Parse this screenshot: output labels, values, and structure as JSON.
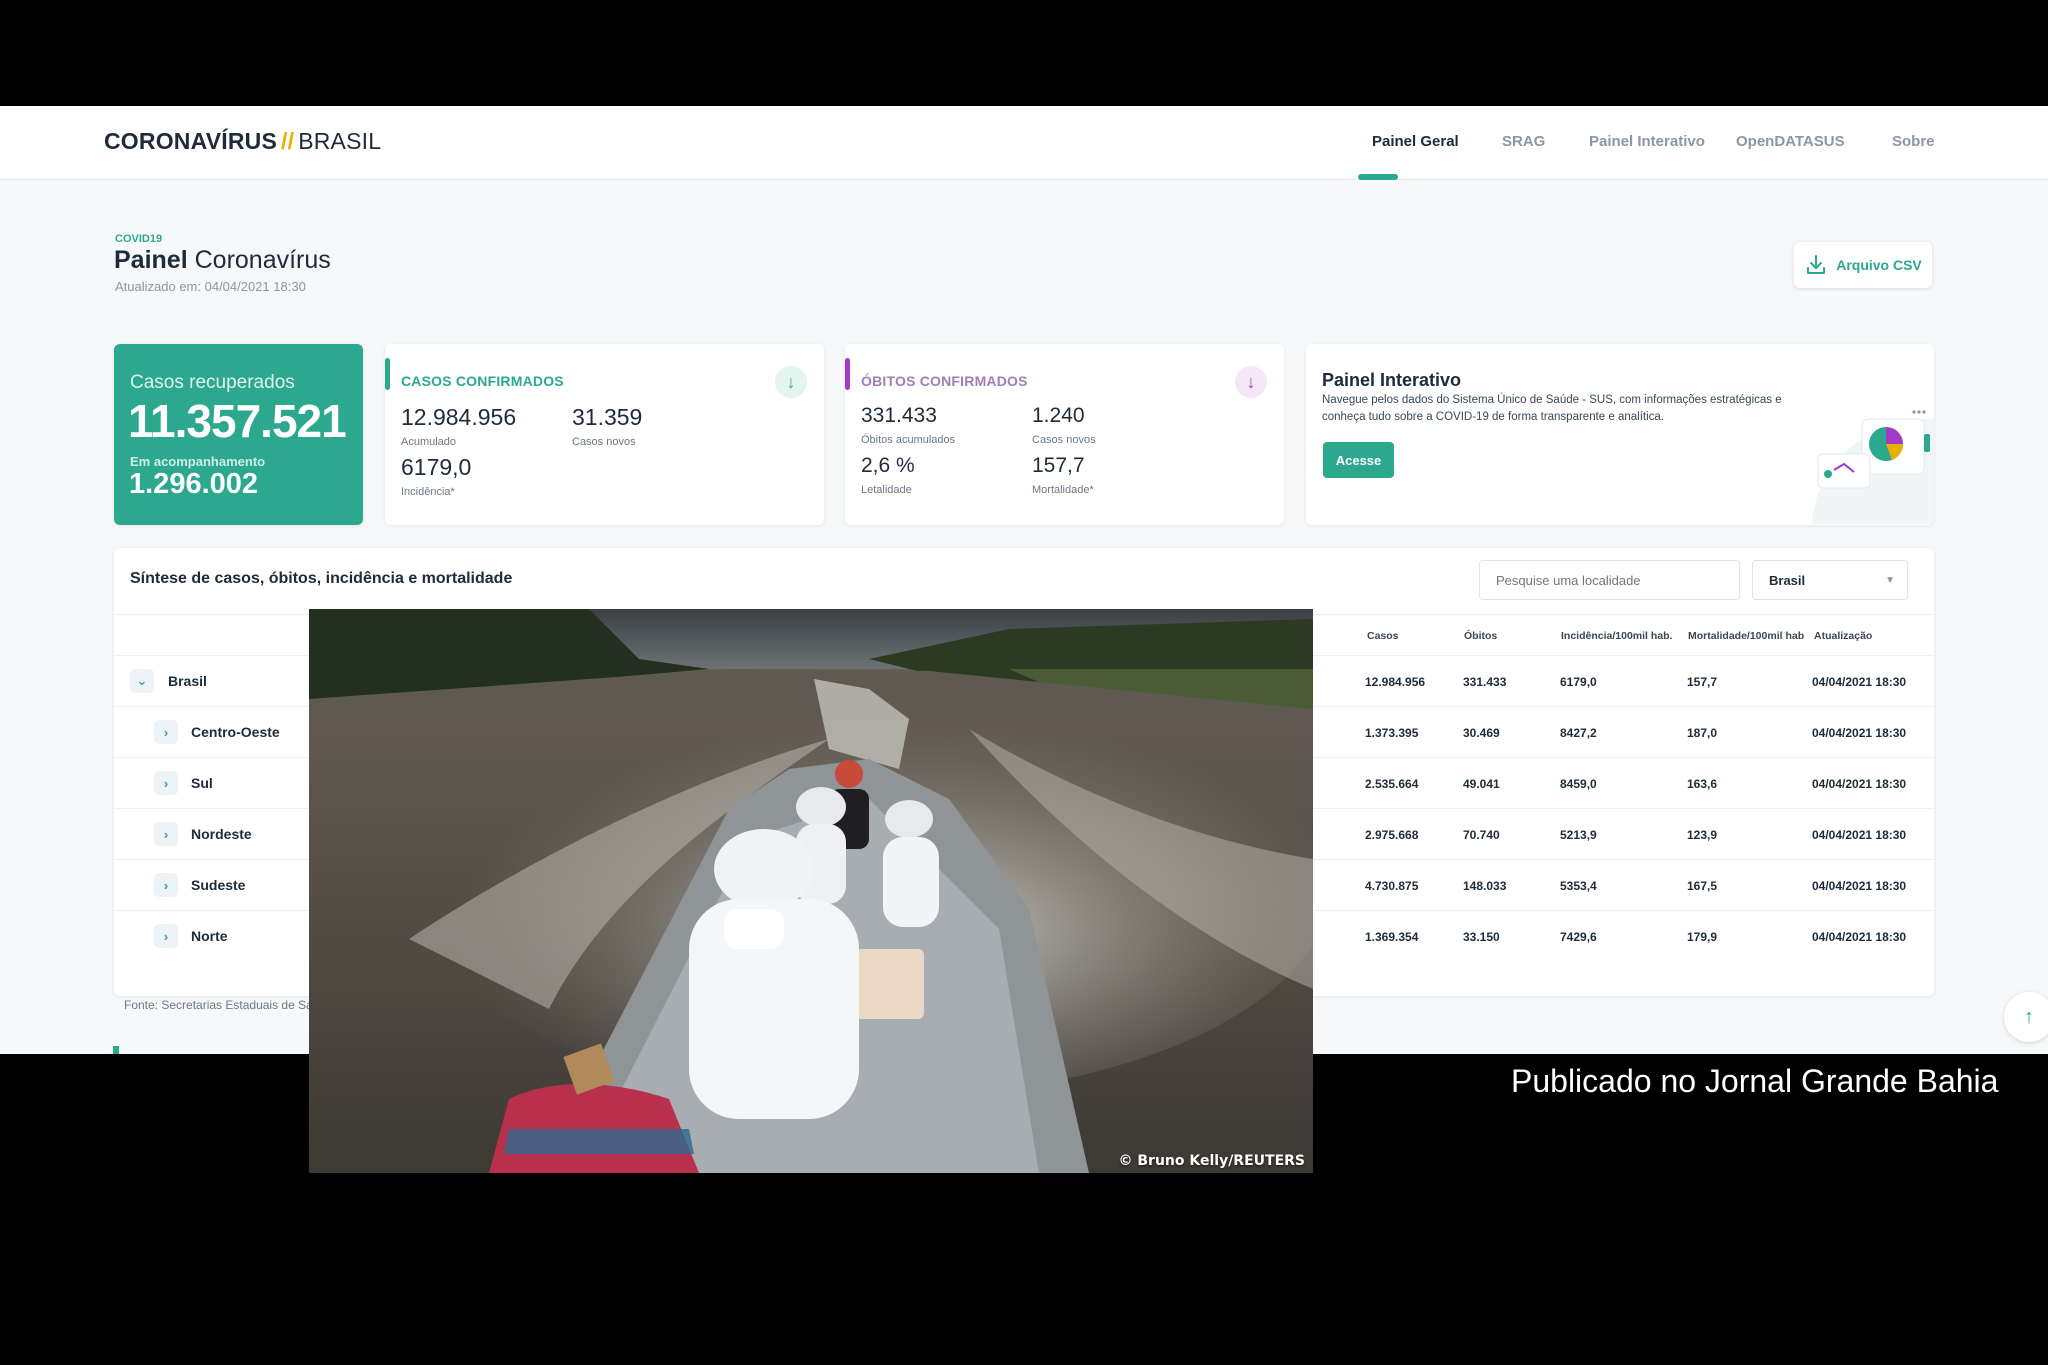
{
  "header": {
    "logo_bold": "CORONAVÍRUS",
    "logo_slash": "//",
    "logo_rest": "BRASIL",
    "nav": [
      {
        "label": "Painel Geral",
        "active": true
      },
      {
        "label": "SRAG"
      },
      {
        "label": "Painel Interativo"
      },
      {
        "label": "OpenDATASUS"
      },
      {
        "label": "Sobre"
      }
    ]
  },
  "page": {
    "kicker": "COVID19",
    "title_bold": "Painel",
    "title_rest": "Coronavírus",
    "updated": "Atualizado em: 04/04/2021 18:30",
    "csv_label": "Arquivo CSV"
  },
  "recovered": {
    "label": "Casos recuperados",
    "value": "11.357.521",
    "follow_label": "Em acompanhamento",
    "follow_value": "1.296.002"
  },
  "confirmed": {
    "title": "CASOS CONFIRMADOS",
    "accum": "12.984.956",
    "accum_label": "Acumulado",
    "new": "31.359",
    "new_label": "Casos novos",
    "incid": "6179,0",
    "incid_label": "Incidência*"
  },
  "deaths": {
    "title": "ÓBITOS CONFIRMADOS",
    "accum": "331.433",
    "accum_label": "Óbitos acumulados",
    "new": "1.240",
    "new_label": "Casos novos",
    "lethality": "2,6 %",
    "lethality_label": "Letalidade",
    "mortality": "157,7",
    "mortality_label": "Mortalidade*"
  },
  "interactive": {
    "title": "Painel Interativo",
    "desc": "Navegue pelos dados do Sistema Único de Saúde - SUS, com informações estratégicas e conheça tudo sobre a COVID-19 de forma transparente e analítica.",
    "button": "Acesse"
  },
  "table": {
    "title": "Síntese de casos, óbitos, incidência e mortalidade",
    "search_placeholder": "Pesquise uma localidade",
    "select_value": "Brasil",
    "headers": [
      "Casos",
      "Óbitos",
      "Incidência/100mil hab.",
      "Mortalidade/100mil hab",
      "Atualização"
    ],
    "rows": [
      {
        "name": "Brasil",
        "cases": "12.984.956",
        "deaths": "331.433",
        "incid": "6179,0",
        "mort": "157,7",
        "date": "04/04/2021 18:30",
        "expanded": true
      },
      {
        "name": "Centro-Oeste",
        "cases": "1.373.395",
        "deaths": "30.469",
        "incid": "8427,2",
        "mort": "187,0",
        "date": "04/04/2021 18:30"
      },
      {
        "name": "Sul",
        "cases": "2.535.664",
        "deaths": "49.041",
        "incid": "8459,0",
        "mort": "163,6",
        "date": "04/04/2021 18:30"
      },
      {
        "name": "Nordeste",
        "cases": "2.975.668",
        "deaths": "70.740",
        "incid": "5213,9",
        "mort": "123,9",
        "date": "04/04/2021 18:30"
      },
      {
        "name": "Sudeste",
        "cases": "4.730.875",
        "deaths": "148.033",
        "incid": "5353,4",
        "mort": "167,5",
        "date": "04/04/2021 18:30"
      },
      {
        "name": "Norte",
        "cases": "1.369.354",
        "deaths": "33.150",
        "incid": "7429,6",
        "mort": "179,9",
        "date": "04/04/2021 18:30"
      }
    ],
    "source": "Fonte: Secretarias Estaduais de Sa"
  },
  "photo": {
    "credit": "© Bruno Kelly/REUTERS"
  },
  "caption": "Publicado no Jornal Grande Bahia",
  "colors": {
    "accent": "#2ba88d",
    "deaths_accent": "#a23cc8",
    "text": "#1d2b3a"
  }
}
